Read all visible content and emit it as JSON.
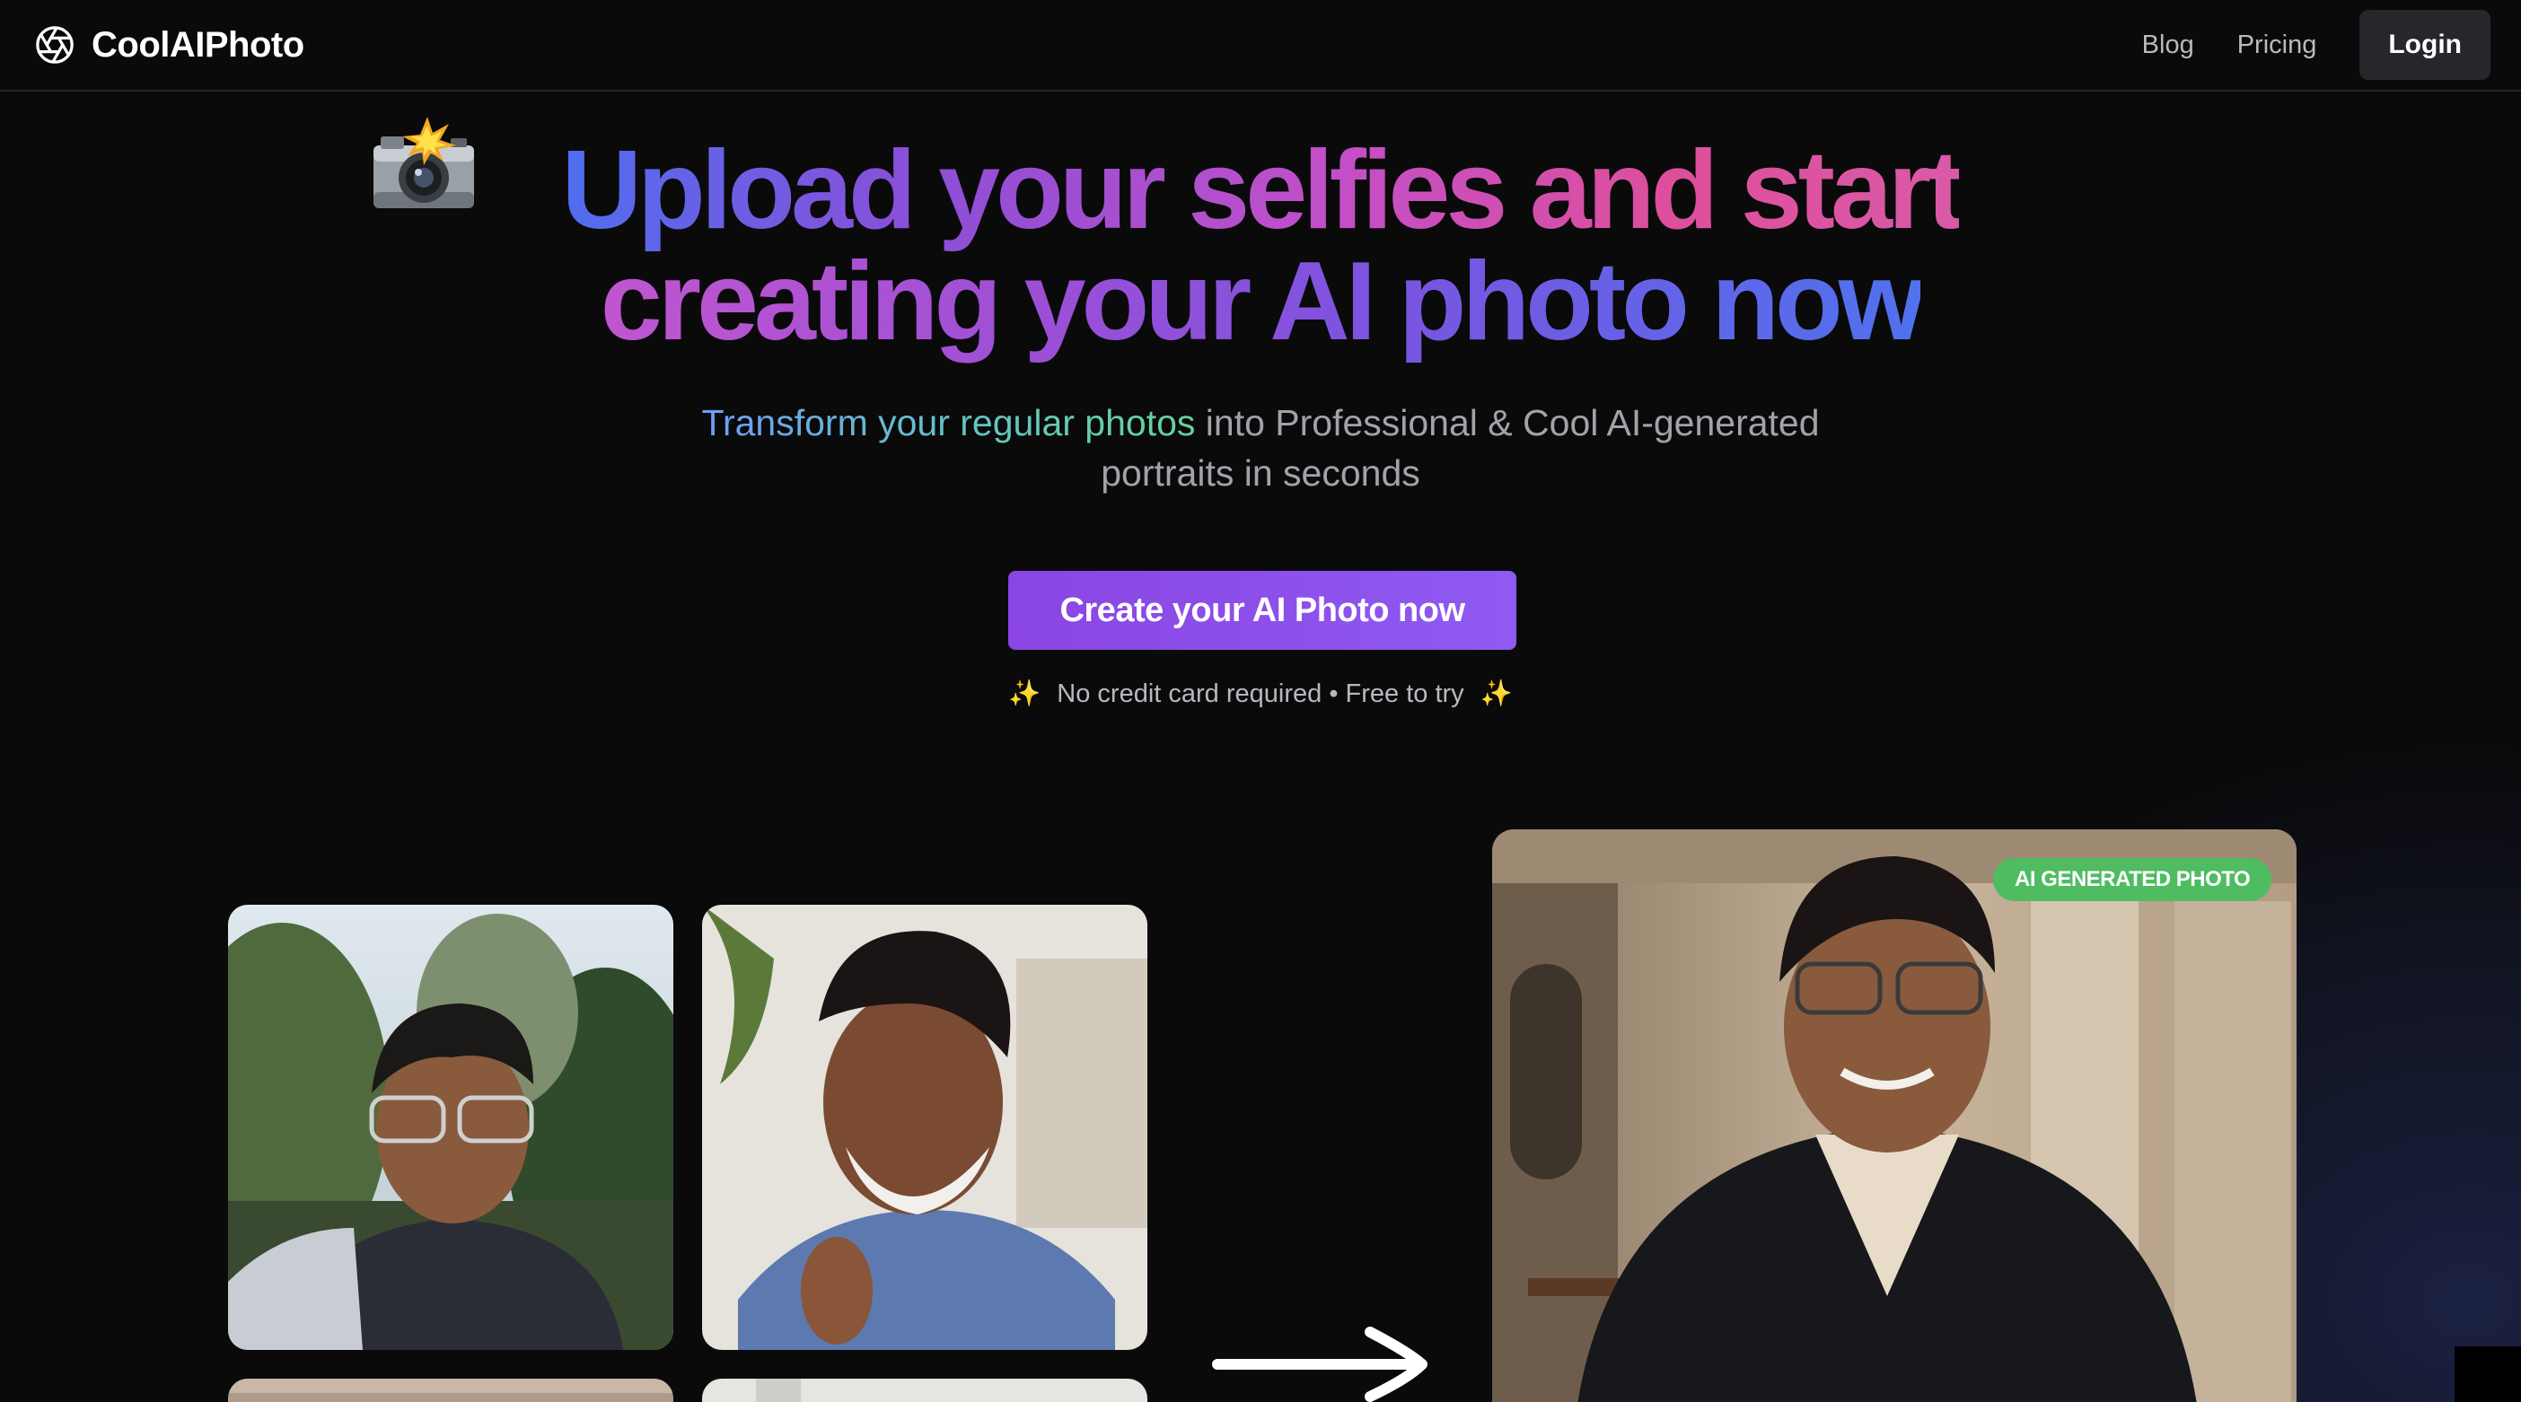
{
  "header": {
    "brand": "CoolAIPhoto",
    "brand_icon": "aperture-icon",
    "nav": {
      "blog": "Blog",
      "pricing": "Pricing",
      "login": "Login"
    }
  },
  "hero": {
    "emoji_icon": "camera-flash-icon",
    "title_line1": "Upload your selfies and start",
    "title_line2": "creating your AI photo now",
    "subtitle_highlight": "Transform your regular photos",
    "subtitle_rest": " into Professional & Cool AI-generated portraits in seconds",
    "cta_label": "Create your AI Photo now",
    "note": "No credit card required • Free to try",
    "note_icon": "✨"
  },
  "gallery": {
    "ai_badge": "AI GENERATED PHOTO",
    "arrow_icon": "arrow-right-icon"
  },
  "colors": {
    "cta": "#8a45e2",
    "badge": "#4fbc62",
    "background": "#0a0a0b"
  }
}
